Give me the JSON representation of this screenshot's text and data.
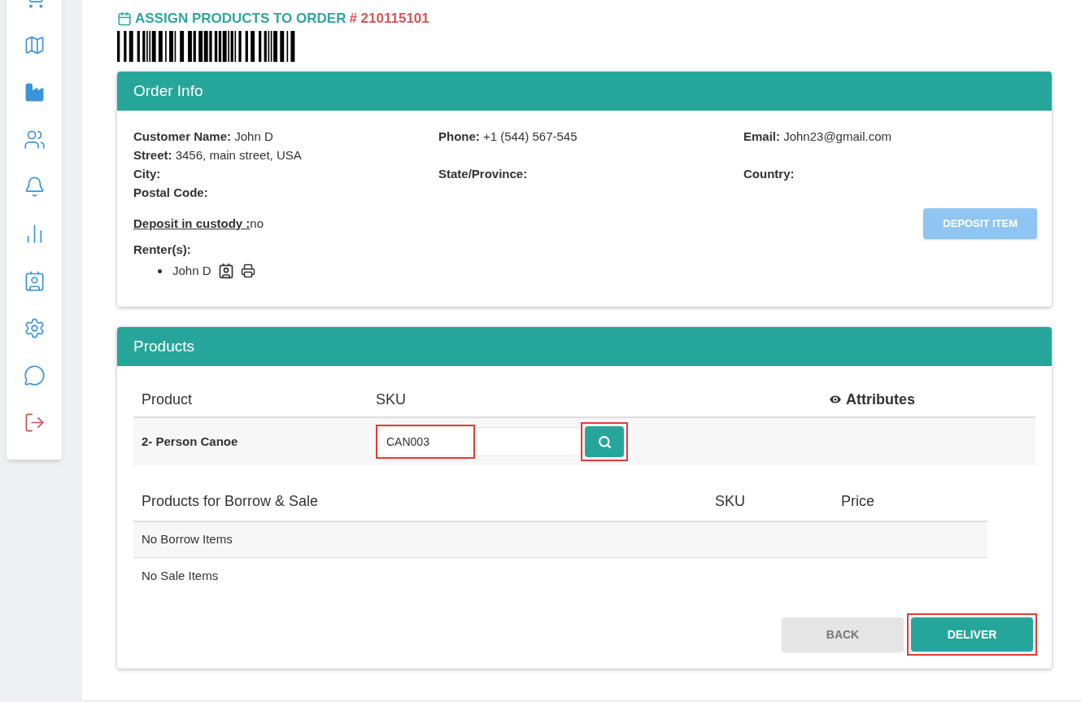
{
  "sidebar": {
    "items": [
      {
        "kind": "cart"
      },
      {
        "kind": "map"
      },
      {
        "kind": "factory"
      },
      {
        "kind": "users"
      },
      {
        "kind": "bell"
      },
      {
        "kind": "chart"
      },
      {
        "kind": "card"
      },
      {
        "kind": "settings"
      },
      {
        "kind": "chat"
      },
      {
        "kind": "logout"
      }
    ]
  },
  "page": {
    "title": "ASSIGN PRODUCTS TO ORDER",
    "order_number": "# 210115101"
  },
  "order_info": {
    "title": "Order Info",
    "field_rows": [
      [
        {
          "label": "Customer Name:",
          "value": "John D"
        },
        {
          "label": "Phone:",
          "value": "+1 (544) 567-545"
        },
        {
          "label": "Email:",
          "value": "John23@gmail.com"
        }
      ],
      [
        {
          "label": "Street:",
          "value": "3456, main street, USA"
        }
      ],
      [
        {
          "label": "City:"
        },
        {
          "label": "State/Province:"
        },
        {
          "label": "Country:"
        }
      ],
      [
        {
          "label": "Postal Code:"
        }
      ]
    ],
    "deposit_label": "Deposit in custody :",
    "deposit_value": "no",
    "deposit_button": {
      "label": "DEPOSIT ITEM",
      "disabled": true
    },
    "renters_label": "Renter(s):",
    "renters": [
      "John D"
    ]
  },
  "products": {
    "title": "Products",
    "columns": [
      "Product",
      "SKU",
      "Attributes"
    ],
    "rows": [
      {
        "product": "2- Person Canoe",
        "sku": "CAN003"
      }
    ],
    "extra_columns": [
      "Products for Borrow & Sale",
      "SKU",
      "Price"
    ],
    "extra_rows": [
      "No Borrow Items",
      "No Sale Items"
    ],
    "buttons": [
      {
        "label": "BACK",
        "kind": "secondary"
      },
      {
        "label": "DELIVER",
        "kind": "primary"
      }
    ]
  }
}
